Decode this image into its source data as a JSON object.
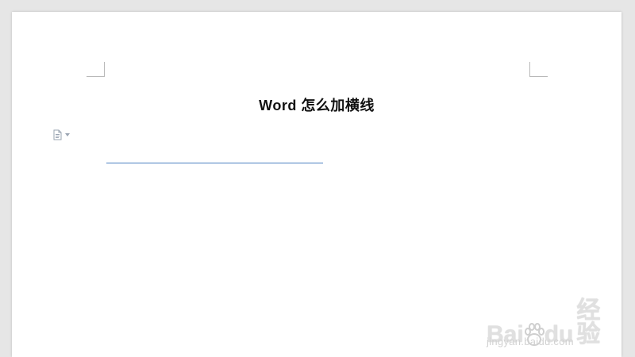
{
  "document": {
    "title": "Word 怎么加横线"
  },
  "paste_options": {
    "icon": "paste-options-icon",
    "dropdown_icon": "chevron-down-icon"
  },
  "horizontal_line": {
    "color": "#4a7fc0"
  },
  "watermark": {
    "logo_text_a": "Bai",
    "logo_text_b": "du",
    "logo_text_c": "经验",
    "url": "jingyan.baidu.com",
    "icon": "paw-icon"
  },
  "colors": {
    "workspace": "#e6e6e6",
    "page": "#ffffff",
    "title": "#111111"
  }
}
